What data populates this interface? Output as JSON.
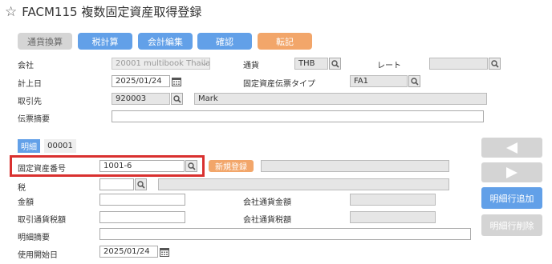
{
  "header": {
    "title": "FACM115 複数固定資産取得登録"
  },
  "toolbar": {
    "currency_convert": "通貨換算",
    "tax_calc": "税計算",
    "accounting_edit": "会計編集",
    "confirm": "確認",
    "post": "転記"
  },
  "form": {
    "company_label": "会社",
    "company_value": "20001 multibook Thaila",
    "currency_label": "通貨",
    "currency_value": "THB",
    "rate_label": "レート",
    "rate_value": "",
    "posting_date_label": "計上日",
    "posting_date_value": "2025/01/24",
    "voucher_type_label": "固定資産伝票タイプ",
    "voucher_type_value": "FA1",
    "partner_label": "取引先",
    "partner_code": "920003",
    "partner_name": "Mark",
    "memo_label": "伝票摘要",
    "memo_value": ""
  },
  "detail": {
    "tab_label": "明細",
    "tab_number": "00001",
    "asset_no_label": "固定資産番号",
    "asset_no_value": "1001-6",
    "new_register": "新規登録",
    "asset_name_value": "",
    "tax_label": "税",
    "tax_value": "",
    "tax_name_value": "",
    "amount_label": "金額",
    "amount_value": "",
    "company_cur_amount_label": "会社通貨金額",
    "company_cur_amount_value": "",
    "trade_tax_label": "取引通貨税額",
    "trade_tax_value": "",
    "company_cur_tax_label": "会社通貨税額",
    "company_cur_tax_value": "",
    "line_memo_label": "明細摘要",
    "line_memo_value": "",
    "start_date_label": "使用開始日",
    "start_date_value": "2025/01/24"
  },
  "side": {
    "add_row": "明細行追加",
    "delete_row": "明細行削除"
  },
  "colors": {
    "blue": "#62a0e8",
    "orange": "#f2a66a",
    "highlight": "#d9302f"
  }
}
